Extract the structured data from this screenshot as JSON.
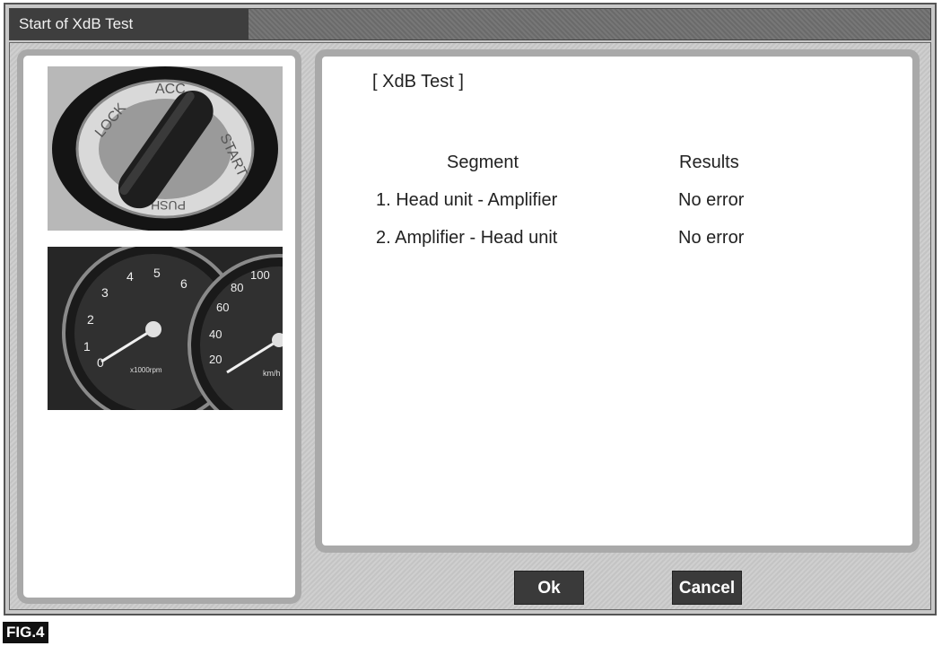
{
  "window": {
    "title": "Start of XdB Test"
  },
  "main": {
    "test_title": "[ XdB Test ]",
    "columns": {
      "segment": "Segment",
      "results": "Results"
    },
    "rows": [
      {
        "segment": "1. Head unit - Amplifier",
        "result": "No error"
      },
      {
        "segment": "2. Amplifier - Head unit",
        "result": "No error"
      }
    ]
  },
  "images": {
    "ignition": {
      "icon": "ignition-switch-photo",
      "labels": {
        "lock": "LOCK",
        "acc": "ACC",
        "start": "START",
        "push": "PUSH"
      }
    },
    "cluster": {
      "icon": "instrument-cluster-photo",
      "tach_ticks": [
        "1",
        "2",
        "3",
        "4",
        "5",
        "6",
        "0"
      ],
      "tach_unit": "x1000rpm",
      "speed_ticks": [
        "100",
        "80",
        "60",
        "40",
        "20"
      ],
      "speed_unit": "km/h"
    }
  },
  "buttons": {
    "ok": "Ok",
    "cancel": "Cancel"
  },
  "figure_label": "FIG.4"
}
